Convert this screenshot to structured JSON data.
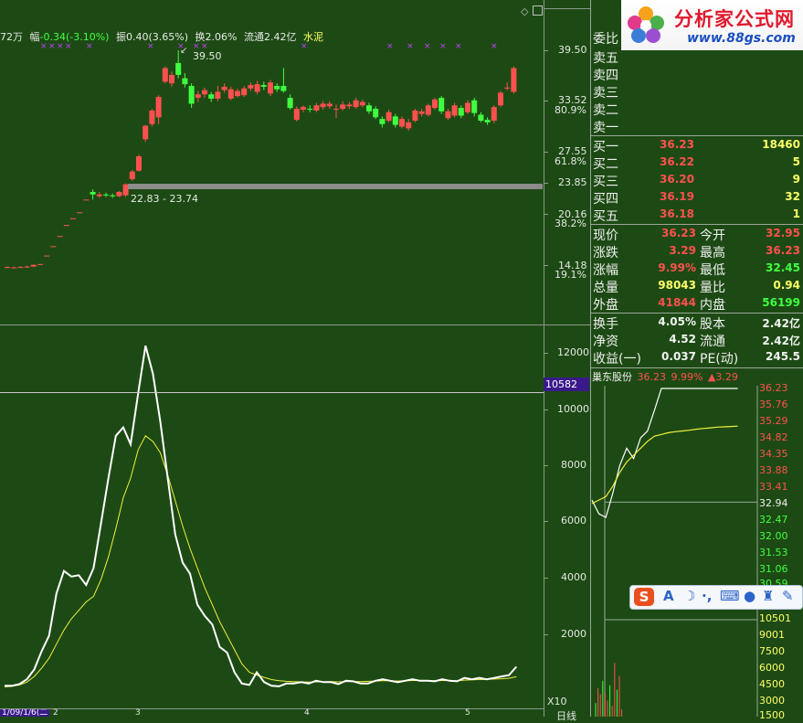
{
  "info_bar": {
    "volume_partial": "72万",
    "fu_label": "幅",
    "fu_value": "-0.34(-3.10%)",
    "zhen_label": "振",
    "zhen_value": "0.40(3.65%)",
    "huan_label": "换",
    "huan_value": "2.06%",
    "liutong_label": "流通",
    "liutong_value": "2.42亿",
    "sector": "水泥"
  },
  "price_axis": {
    "ticks": [
      "39.50",
      "33.52",
      "27.55",
      "23.85",
      "20.16",
      "14.18"
    ],
    "pcts": [
      "80.9%",
      "61.8%",
      "38.2%",
      "19.1%"
    ]
  },
  "annotations": {
    "high": "39.50",
    "range": "22.83 - 23.74"
  },
  "volume_axis": {
    "ticks": [
      "12000",
      "10000",
      "8000",
      "6000",
      "4000",
      "2000"
    ],
    "marker": "10582",
    "multiplier": "X10"
  },
  "bottom_labels": {
    "date_partial": "1/09/1/6(二",
    "month_2": "2",
    "month_3": "3",
    "month_4": "4",
    "month_5": "5",
    "period": "日线"
  },
  "order_book": {
    "header": "委比",
    "sells": [
      {
        "label": "卖五"
      },
      {
        "label": "卖四"
      },
      {
        "label": "卖三"
      },
      {
        "label": "卖二"
      },
      {
        "label": "卖一"
      }
    ],
    "buys": [
      {
        "label": "买一",
        "price": "36.23",
        "vol": "18460"
      },
      {
        "label": "买二",
        "price": "36.22",
        "vol": "5"
      },
      {
        "label": "买三",
        "price": "36.20",
        "vol": "9"
      },
      {
        "label": "买四",
        "price": "36.19",
        "vol": "32"
      },
      {
        "label": "买五",
        "price": "36.18",
        "vol": "1"
      }
    ]
  },
  "stats": [
    {
      "l1": "现价",
      "v1": "36.23",
      "l2": "今开",
      "v2": "32.95"
    },
    {
      "l1": "涨跌",
      "v1": "3.29",
      "l2": "最高",
      "v2": "36.23"
    },
    {
      "l1": "涨幅",
      "v1": "9.99%",
      "l2": "最低",
      "v2": "32.45"
    },
    {
      "l1": "总量",
      "v1": "98043",
      "l2": "量比",
      "v2": "0.94"
    },
    {
      "l1": "外盘",
      "v1": "41844",
      "l2": "内盘",
      "v2": "56199"
    },
    {
      "l1": "换手",
      "v1": "4.05%",
      "l2": "股本",
      "v2": "2.42亿"
    },
    {
      "l1": "净资",
      "v1": "4.52",
      "l2": "流通",
      "v2": "2.42亿"
    },
    {
      "l1": "收益(一)",
      "v1": "0.037",
      "l2": "PE(动)",
      "v2": "245.5"
    }
  ],
  "mini_chart": {
    "stock_name": "巢东股份",
    "price": "36.23",
    "pct": "9.99%",
    "change": "▲3.29",
    "price_ticks": [
      "36.23",
      "35.76",
      "35.29",
      "34.82",
      "34.35",
      "33.88",
      "33.41",
      "32.94",
      "32.47",
      "32.00",
      "31.53",
      "31.06",
      "30.59"
    ],
    "vol_ticks": [
      "10501",
      "9001",
      "7500",
      "6000",
      "4500",
      "3000",
      "1500"
    ]
  },
  "logo": {
    "text": "分析家公式网",
    "url": "www.88gs.com"
  },
  "ime": {
    "letter": "S",
    "mode": "A"
  },
  "colors": {
    "bg": "#1d4a14",
    "up": "#ff5050",
    "down": "#40ff40",
    "volume_line": "#ffffff",
    "ma_line": "#f0f03c",
    "grid": "#8a9a8a",
    "marker_bg": "#3a1a8a"
  },
  "candles": [
    {
      "o": 13.9,
      "c": 13.95,
      "h": 14.0,
      "l": 13.8
    },
    {
      "o": 13.85,
      "c": 13.9,
      "h": 14.0,
      "l": 13.8
    },
    {
      "o": 13.9,
      "c": 13.95,
      "h": 14.05,
      "l": 13.85
    },
    {
      "o": 13.9,
      "c": 14.0,
      "h": 14.1,
      "l": 13.85
    },
    {
      "o": 14.0,
      "c": 14.2,
      "h": 14.25,
      "l": 13.95
    },
    {
      "o": 14.3,
      "c": 14.3,
      "h": 14.3,
      "l": 14.3
    },
    {
      "o": 15.3,
      "c": 15.3,
      "h": 15.3,
      "l": 15.3
    },
    {
      "o": 16.4,
      "c": 16.4,
      "h": 16.4,
      "l": 16.4
    },
    {
      "o": 17.6,
      "c": 17.6,
      "h": 17.6,
      "l": 17.6
    },
    {
      "o": 18.9,
      "c": 18.9,
      "h": 18.9,
      "l": 18.9
    },
    {
      "o": 19.7,
      "c": 19.7,
      "h": 19.7,
      "l": 19.7
    },
    {
      "o": 20.4,
      "c": 20.4,
      "h": 20.4,
      "l": 20.4
    },
    {
      "o": 21.9,
      "c": 21.9,
      "h": 21.9,
      "l": 21.9
    },
    {
      "o": 22.8,
      "c": 22.5,
      "h": 23.1,
      "l": 21.9
    },
    {
      "o": 22.3,
      "c": 22.5,
      "h": 22.8,
      "l": 22.1
    },
    {
      "o": 22.5,
      "c": 22.4,
      "h": 22.7,
      "l": 22.2
    },
    {
      "o": 22.4,
      "c": 22.3,
      "h": 22.6,
      "l": 22.1
    },
    {
      "o": 22.3,
      "c": 22.8,
      "h": 22.9,
      "l": 22.2
    },
    {
      "o": 22.4,
      "c": 23.7,
      "h": 23.8,
      "l": 22.2
    },
    {
      "o": 24.3,
      "c": 25.2,
      "h": 25.4,
      "l": 24.1
    },
    {
      "o": 25.3,
      "c": 27.0,
      "h": 27.2,
      "l": 25.2
    },
    {
      "o": 29.0,
      "c": 30.6,
      "h": 30.7,
      "l": 28.7
    },
    {
      "o": 30.8,
      "c": 32.4,
      "h": 32.6,
      "l": 30.5
    },
    {
      "o": 31.6,
      "c": 34.0,
      "h": 34.2,
      "l": 30.8
    },
    {
      "o": 35.8,
      "c": 37.4,
      "h": 37.6,
      "l": 35.6
    },
    {
      "o": 35.6,
      "c": 36.6,
      "h": 37.0,
      "l": 35.2
    },
    {
      "o": 38.0,
      "c": 36.6,
      "h": 39.5,
      "l": 36.2
    },
    {
      "o": 36.2,
      "c": 35.5,
      "h": 36.8,
      "l": 35.1
    },
    {
      "o": 35.3,
      "c": 33.2,
      "h": 35.6,
      "l": 32.7
    },
    {
      "o": 33.9,
      "c": 34.3,
      "h": 34.7,
      "l": 33.4
    },
    {
      "o": 34.3,
      "c": 34.8,
      "h": 35.1,
      "l": 33.9
    },
    {
      "o": 34.3,
      "c": 33.8,
      "h": 34.6,
      "l": 33.4
    },
    {
      "o": 33.8,
      "c": 34.6,
      "h": 35.3,
      "l": 33.5
    },
    {
      "o": 34.8,
      "c": 35.2,
      "h": 35.6,
      "l": 34.5
    },
    {
      "o": 33.8,
      "c": 34.9,
      "h": 35.2,
      "l": 33.6
    },
    {
      "o": 34.1,
      "c": 34.7,
      "h": 35.0,
      "l": 33.9
    },
    {
      "o": 34.2,
      "c": 35.0,
      "h": 35.3,
      "l": 34.0
    },
    {
      "o": 35.0,
      "c": 35.4,
      "h": 35.7,
      "l": 34.7
    },
    {
      "o": 34.6,
      "c": 35.5,
      "h": 35.9,
      "l": 34.3
    },
    {
      "o": 35.4,
      "c": 35.2,
      "h": 35.8,
      "l": 34.8
    },
    {
      "o": 34.4,
      "c": 35.7,
      "h": 36.0,
      "l": 34.1
    },
    {
      "o": 35.3,
      "c": 34.9,
      "h": 35.6,
      "l": 34.6
    },
    {
      "o": 35.3,
      "c": 34.7,
      "h": 37.4,
      "l": 34.5
    },
    {
      "o": 33.9,
      "c": 32.7,
      "h": 34.3,
      "l": 32.5
    },
    {
      "o": 31.3,
      "c": 32.6,
      "h": 32.9,
      "l": 31.1
    },
    {
      "o": 32.5,
      "c": 32.8,
      "h": 33.0,
      "l": 32.2
    },
    {
      "o": 32.6,
      "c": 32.5,
      "h": 33.0,
      "l": 32.2
    },
    {
      "o": 32.4,
      "c": 33.0,
      "h": 33.3,
      "l": 32.2
    },
    {
      "o": 32.8,
      "c": 33.2,
      "h": 33.5,
      "l": 32.5
    },
    {
      "o": 32.9,
      "c": 33.2,
      "h": 33.5,
      "l": 32.6
    },
    {
      "o": 32.6,
      "c": 32.6,
      "h": 33.1,
      "l": 31.5
    },
    {
      "o": 32.6,
      "c": 33.1,
      "h": 33.5,
      "l": 32.4
    },
    {
      "o": 32.9,
      "c": 33.1,
      "h": 33.4,
      "l": 32.6
    },
    {
      "o": 32.8,
      "c": 33.6,
      "h": 33.9,
      "l": 32.6
    },
    {
      "o": 33.0,
      "c": 33.4,
      "h": 33.7,
      "l": 32.8
    },
    {
      "o": 33.0,
      "c": 32.3,
      "h": 33.3,
      "l": 32.0
    },
    {
      "o": 32.6,
      "c": 31.6,
      "h": 32.9,
      "l": 31.4
    },
    {
      "o": 31.4,
      "c": 30.8,
      "h": 31.7,
      "l": 30.4
    },
    {
      "o": 31.2,
      "c": 32.2,
      "h": 32.5,
      "l": 31.0
    },
    {
      "o": 31.7,
      "c": 30.7,
      "h": 32.0,
      "l": 30.4
    },
    {
      "o": 30.5,
      "c": 31.4,
      "h": 31.7,
      "l": 30.3
    },
    {
      "o": 30.3,
      "c": 31.0,
      "h": 31.4,
      "l": 30.0
    },
    {
      "o": 31.2,
      "c": 32.4,
      "h": 32.6,
      "l": 31.0
    },
    {
      "o": 32.0,
      "c": 32.3,
      "h": 32.6,
      "l": 31.7
    },
    {
      "o": 31.9,
      "c": 33.0,
      "h": 33.2,
      "l": 31.7
    },
    {
      "o": 32.7,
      "c": 33.7,
      "h": 33.9,
      "l": 32.5
    },
    {
      "o": 33.9,
      "c": 32.3,
      "h": 34.1,
      "l": 32.0
    },
    {
      "o": 31.5,
      "c": 32.3,
      "h": 32.6,
      "l": 31.3
    },
    {
      "o": 31.8,
      "c": 33.0,
      "h": 33.3,
      "l": 31.6
    },
    {
      "o": 32.7,
      "c": 31.8,
      "h": 33.0,
      "l": 31.5
    },
    {
      "o": 32.2,
      "c": 33.3,
      "h": 33.6,
      "l": 32.0
    },
    {
      "o": 33.6,
      "c": 32.1,
      "h": 33.9,
      "l": 31.7
    },
    {
      "o": 31.9,
      "c": 31.2,
      "h": 32.2,
      "l": 31.0
    },
    {
      "o": 31.3,
      "c": 31.0,
      "h": 31.6,
      "l": 30.7
    },
    {
      "o": 31.2,
      "c": 32.8,
      "h": 33.0,
      "l": 30.9
    },
    {
      "o": 33.0,
      "c": 34.5,
      "h": 34.7,
      "l": 32.8
    },
    {
      "o": 35.1,
      "c": 35.1,
      "h": 35.7,
      "l": 34.8
    },
    {
      "o": 34.6,
      "c": 37.4,
      "h": 37.6,
      "l": 34.4
    }
  ],
  "vol_series": [
    120,
    120,
    180,
    350,
    700,
    1350,
    1900,
    3400,
    4200,
    4000,
    4050,
    3700,
    4300,
    5900,
    7500,
    9000,
    9300,
    8700,
    10500,
    12200,
    11200,
    9500,
    7500,
    5500,
    4500,
    4100,
    3000,
    2600,
    2300,
    1500,
    1300,
    600,
    200,
    150,
    600,
    250,
    120,
    100,
    200,
    200,
    250,
    200,
    300,
    250,
    250,
    180,
    300,
    280,
    200,
    200,
    300,
    350,
    300,
    250,
    300,
    350,
    300,
    300,
    280,
    350,
    300,
    280,
    400,
    350,
    400,
    350,
    400,
    450,
    500,
    800
  ],
  "ma_series": [
    80,
    100,
    150,
    250,
    450,
    750,
    1100,
    1600,
    2100,
    2500,
    2800,
    3100,
    3300,
    3900,
    4700,
    5700,
    6800,
    7500,
    8500,
    9000,
    8800,
    8400,
    7600,
    6700,
    5800,
    5000,
    4300,
    3600,
    3000,
    2400,
    1900,
    1400,
    900,
    600,
    500,
    420,
    340,
    300,
    280,
    270,
    260,
    250,
    260,
    260,
    270,
    260,
    270,
    275,
    270,
    280,
    290,
    300,
    300,
    290,
    300,
    310,
    310,
    300,
    300,
    310,
    310,
    300,
    320,
    330,
    340,
    350,
    360,
    370,
    390,
    440
  ],
  "mini_price": [
    33.0,
    32.6,
    32.5,
    33.2,
    34.0,
    34.5,
    34.2,
    34.8,
    35.0,
    35.6,
    36.23,
    36.23,
    36.23,
    36.23,
    36.23,
    36.23,
    36.23,
    36.23,
    36.23,
    36.23,
    36.23,
    36.23
  ],
  "mini_avg": [
    32.9,
    33.0,
    33.1,
    33.4,
    33.8,
    34.1,
    34.3,
    34.5,
    34.7,
    34.85,
    34.9,
    34.95,
    34.98,
    35.0,
    35.02,
    35.05,
    35.07,
    35.09,
    35.11,
    35.12,
    35.13,
    35.14
  ],
  "mini_vol": [
    1500,
    3200,
    2500,
    4000,
    2700,
    1800,
    3500,
    1200,
    6000,
    3000,
    4500,
    800
  ]
}
